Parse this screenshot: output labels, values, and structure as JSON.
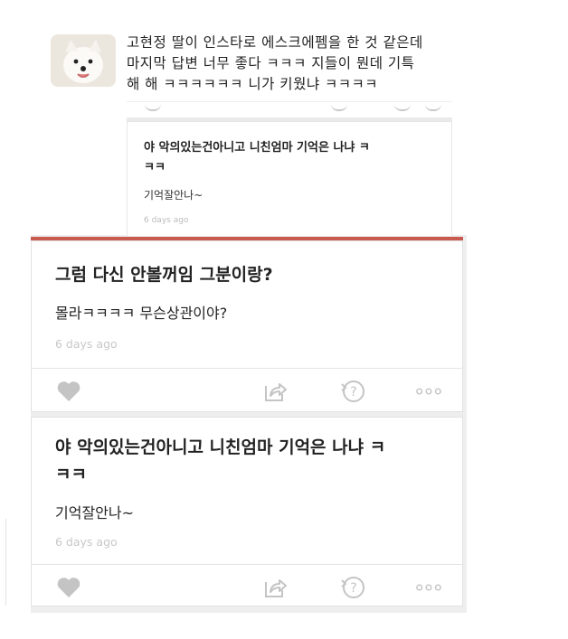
{
  "top_post": {
    "lines": [
      "고현정 딸이 인스타로 에스크에펨을 한 것 같은데",
      "마지막 답변 너무 좋다 ㅋㅋㅋ 지들이 뭔데 기특",
      "해 해 ㅋㅋㅋㅋㅋㅋ 니가 키웠냐 ㅋㅋㅋㅋ"
    ],
    "quoted": {
      "question_lines": [
        "야 악의있는건아니고 니친엄마 기억은 나냐 ㅋ",
        "ㅋㅋ"
      ],
      "answer": "기억잘안나~",
      "time": "6 days ago"
    }
  },
  "cards": [
    {
      "question_lines": [
        "그럼 다신 안볼꺼임 그분이랑?"
      ],
      "answer": "몰라ㅋㅋㅋㅋ 무슨상관이야?",
      "time": "6 days ago"
    },
    {
      "question_lines": [
        "야 악의있는건아니고 니친엄마 기억은 나냐 ㅋ",
        "ㅋㅋ"
      ],
      "answer": "기억잘안나~",
      "time": "6 days ago"
    }
  ],
  "icons": {
    "like": "heart-icon",
    "share": "share-icon",
    "ask": "question-bubble-icon",
    "more": "more-dots-icon"
  },
  "colors": {
    "divider": "#c85a50",
    "icon": "#c4c4c4",
    "time": "#c8c8c8"
  }
}
